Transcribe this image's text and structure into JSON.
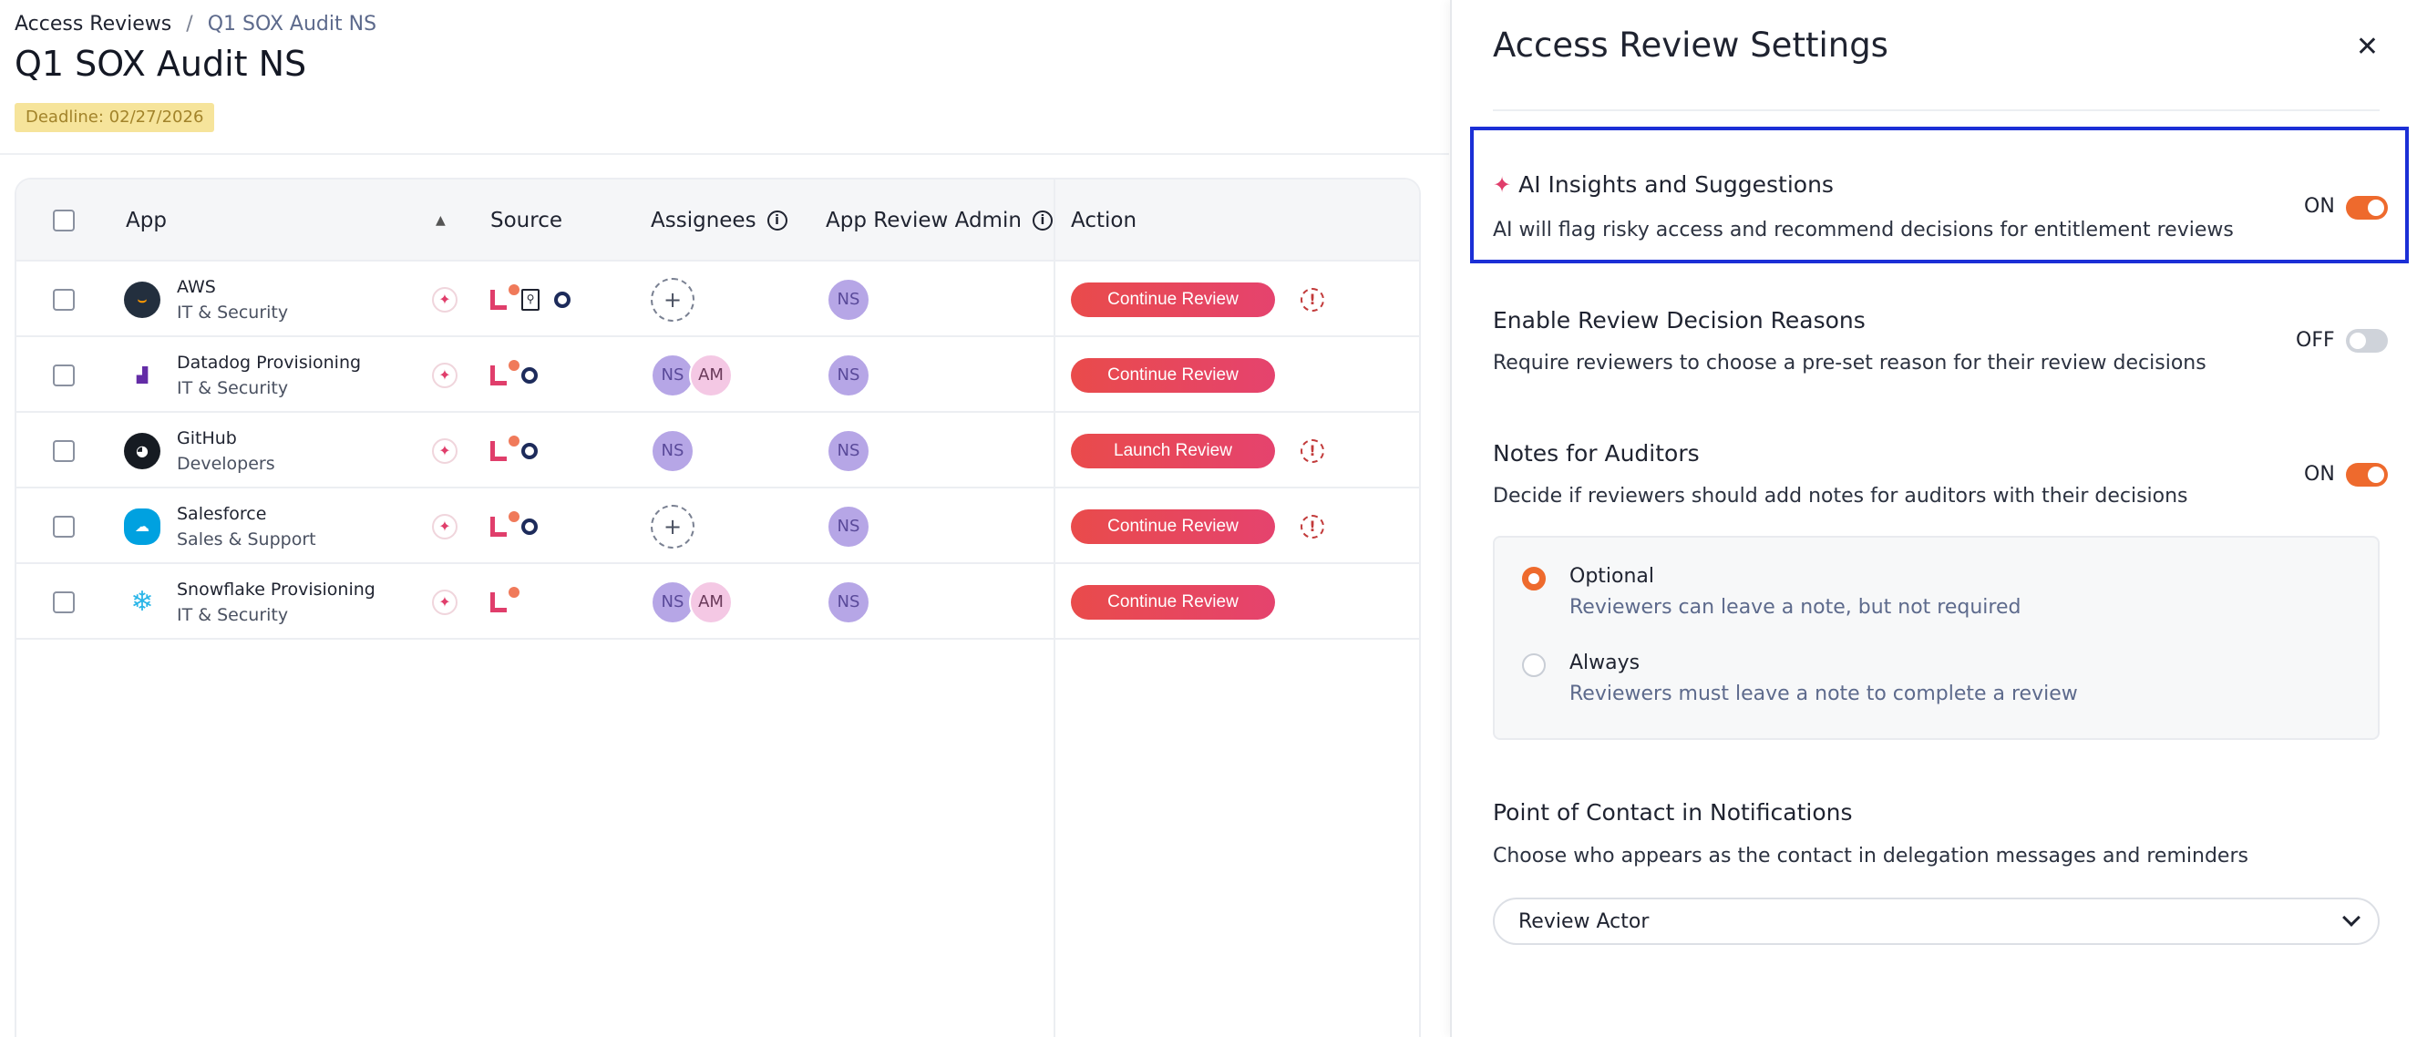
{
  "breadcrumb": {
    "root": "Access Reviews",
    "separator": "/",
    "current": "Q1 SOX Audit NS"
  },
  "page": {
    "title": "Q1 SOX Audit NS",
    "deadline": "Deadline: 02/27/2026"
  },
  "table": {
    "headers": {
      "app": "App",
      "source": "Source",
      "assignees": "Assignees",
      "admin": "App Review Admin",
      "action": "Action"
    },
    "rows": [
      {
        "name": "AWS",
        "group": "IT & Security",
        "logo": "aws-logo",
        "assignees": [],
        "admin": "NS",
        "action": "Continue Review",
        "alert": true,
        "extra_source": true
      },
      {
        "name": "Datadog Provisioning",
        "group": "IT & Security",
        "logo": "datadog-logo",
        "assignees": [
          "NS",
          "AM"
        ],
        "admin": "NS",
        "action": "Continue Review",
        "alert": false,
        "extra_source": false
      },
      {
        "name": "GitHub",
        "group": "Developers",
        "logo": "github-logo",
        "assignees": [
          "NS"
        ],
        "admin": "NS",
        "action": "Launch Review",
        "alert": true,
        "extra_source": false
      },
      {
        "name": "Salesforce",
        "group": "Sales & Support",
        "logo": "salesforce-logo",
        "assignees": [],
        "admin": "NS",
        "action": "Continue Review",
        "alert": true,
        "extra_source": false
      },
      {
        "name": "Snowflake Provisioning",
        "group": "IT & Security",
        "logo": "snowflake-logo",
        "assignees": [
          "NS",
          "AM"
        ],
        "admin": "NS",
        "action": "Continue Review",
        "alert": false,
        "extra_source": false
      }
    ]
  },
  "panel": {
    "title": "Access Review Settings",
    "ai": {
      "title": "AI Insights and Suggestions",
      "desc": "AI will flag risky access and recommend decisions for entitlement reviews",
      "state": "ON"
    },
    "reasons": {
      "title": "Enable Review Decision Reasons",
      "desc": "Require reviewers to choose a pre-set reason for their review decisions",
      "state": "OFF"
    },
    "notes": {
      "title": "Notes for Auditors",
      "desc": "Decide if reviewers should add notes for auditors with their decisions",
      "state": "ON",
      "options": [
        {
          "title": "Optional",
          "desc": "Reviewers can leave a note, but not required",
          "selected": true
        },
        {
          "title": "Always",
          "desc": "Reviewers must leave a note to complete a review",
          "selected": false
        }
      ]
    },
    "contact": {
      "title": "Point of Contact in Notifications",
      "desc": "Choose who appears as the contact in delegation messages and reminders",
      "value": "Review Actor"
    }
  },
  "colors": {
    "accent": "#ee6a2d",
    "brand_pink": "#e03e6b",
    "highlight": "#1b2fd6"
  }
}
